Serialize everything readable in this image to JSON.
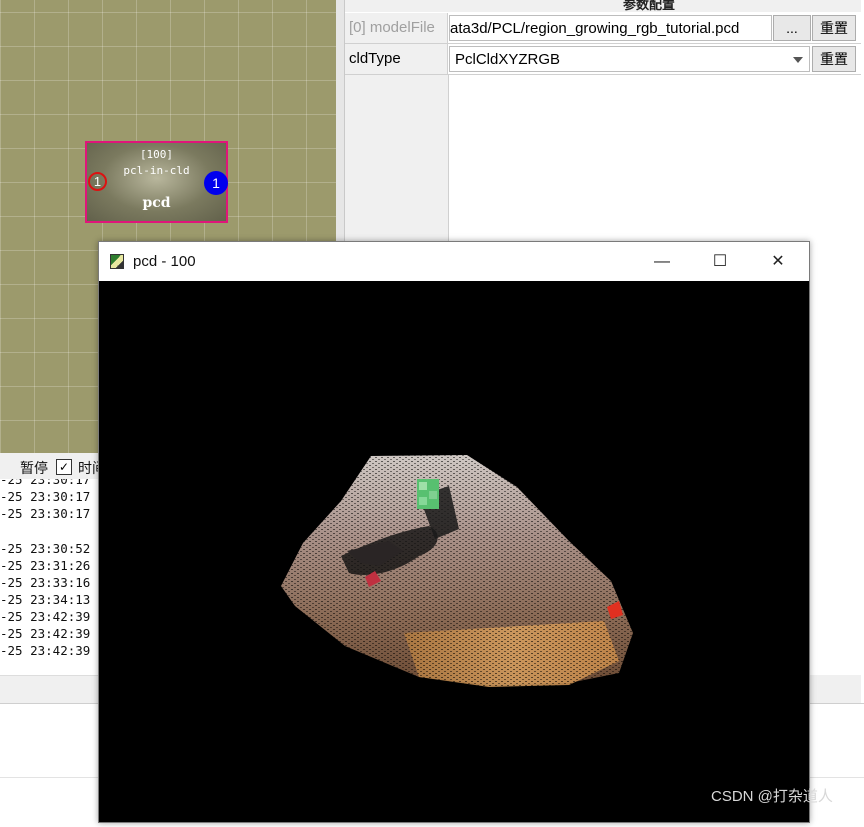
{
  "node_editor": {
    "node": {
      "id_label": "[100]",
      "type_label": "pcl-in-cld",
      "name_label": "pcd",
      "input_port": "1",
      "output_port": "1"
    }
  },
  "params_panel": {
    "header": "参数配置",
    "rows": [
      {
        "label": "[0] modelFile",
        "value": "ata3d/PCL/region_growing_rgb_tutorial.pcd",
        "browse_label": "...",
        "reset_label": "重置"
      },
      {
        "label": "cldType",
        "value": "PclCldXYZRGB",
        "reset_label": "重置"
      }
    ]
  },
  "log": {
    "pause_label": "暂停",
    "pause_checked_glyph": "✓",
    "time_label": "时间",
    "lines": [
      "-25 23:30:17",
      "-25 23:30:17",
      "-25 23:30:17",
      "",
      "-25 23:30:52",
      "-25 23:31:26",
      "-25 23:33:16",
      "-25 23:34:13",
      "-25 23:42:39",
      "-25 23:42:39",
      "-25 23:42:39"
    ]
  },
  "viewer_window": {
    "title": "pcd - 100",
    "minimize_glyph": "—",
    "maximize_glyph": "☐",
    "close_glyph": "✕"
  },
  "watermark": "CSDN @打杂道人",
  "colors": {
    "node_border": "#e0157a",
    "input_port": "#dd1111",
    "output_port": "#0000ee",
    "canvas_bg": "#9c9a6c",
    "viewer_bg": "#000000"
  }
}
